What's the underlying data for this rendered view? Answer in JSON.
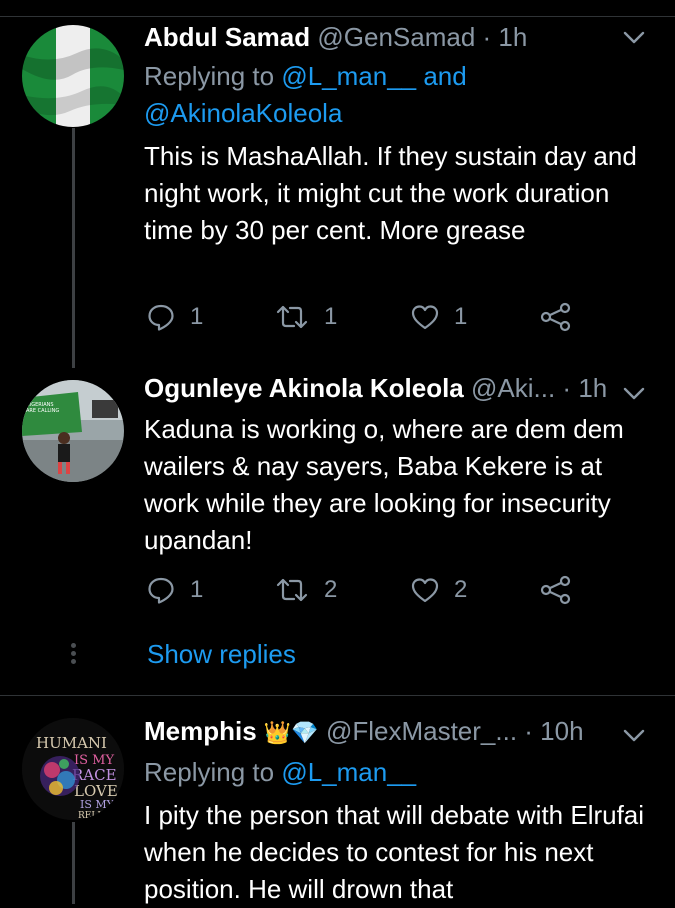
{
  "tweets": [
    {
      "name": "Abdul Samad",
      "emoji": "",
      "handle": "@GenSamad",
      "sep": " · ",
      "time": "1h",
      "replying_prefix": "Replying to ",
      "replying_to": [
        "@L_man__",
        " and",
        "@AkinolaKoleola"
      ],
      "body": "This is MashaAllah. If they sustain day and night work, it might cut the work duration time by 30 per cent. More grease",
      "replies": "1",
      "retweets": "1",
      "likes": "1"
    },
    {
      "name": "Ogunleye Akinola Koleola",
      "handle": "@Aki...",
      "sep": " · ",
      "time": "1h",
      "body": "Kaduna is working o, where are dem dem wailers & nay sayers, Baba Kekere is at work while they are looking for insecurity upandan!",
      "replies": "1",
      "retweets": "2",
      "likes": "2",
      "show_replies": "Show replies"
    },
    {
      "name": "Memphis",
      "emoji": "👑💎",
      "handle": "@FlexMaster_...",
      "sep": " · ",
      "time": "10h",
      "replying_prefix": "Replying to ",
      "replying_to": [
        "@L_man__"
      ],
      "body": "I pity the person that will debate with Elrufai when he decides to contest for his next position. He will drown that",
      "avatar_text": [
        "HUMANI",
        "IS MY",
        "RACE",
        "LOVE",
        "IS MY",
        "RELIG"
      ]
    }
  ],
  "colors": {
    "background": "#000000",
    "link": "#1d9bf0",
    "muted": "#8b98a5",
    "divider": "#2f3336"
  },
  "icons": [
    "chevron-down-icon",
    "reply-icon",
    "retweet-icon",
    "like-icon",
    "share-icon"
  ]
}
